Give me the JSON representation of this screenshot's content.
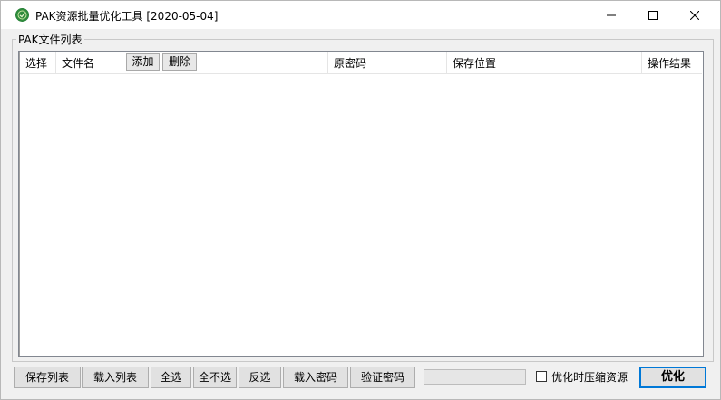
{
  "window": {
    "title": "PAK资源批量优化工具 [2020-05-04]",
    "icon": "app-logo-icon"
  },
  "group": {
    "label": "PAK文件列表"
  },
  "list": {
    "columns": [
      "选择",
      "文件名",
      "原密码",
      "保存位置",
      "操作结果"
    ],
    "add_label": "添加",
    "delete_label": "删除",
    "rows": []
  },
  "toolbar": {
    "save_list": "保存列表",
    "load_list": "载入列表",
    "select_all": "全选",
    "select_none": "全不选",
    "invert": "反选",
    "load_password": "载入密码",
    "verify_password": "验证密码",
    "progress": 0,
    "compress_label": "优化时压缩资源",
    "compress_checked": false,
    "optimize": "优化"
  },
  "colors": {
    "icon_green": "#1f7a32",
    "focus_blue": "#0078d7"
  }
}
